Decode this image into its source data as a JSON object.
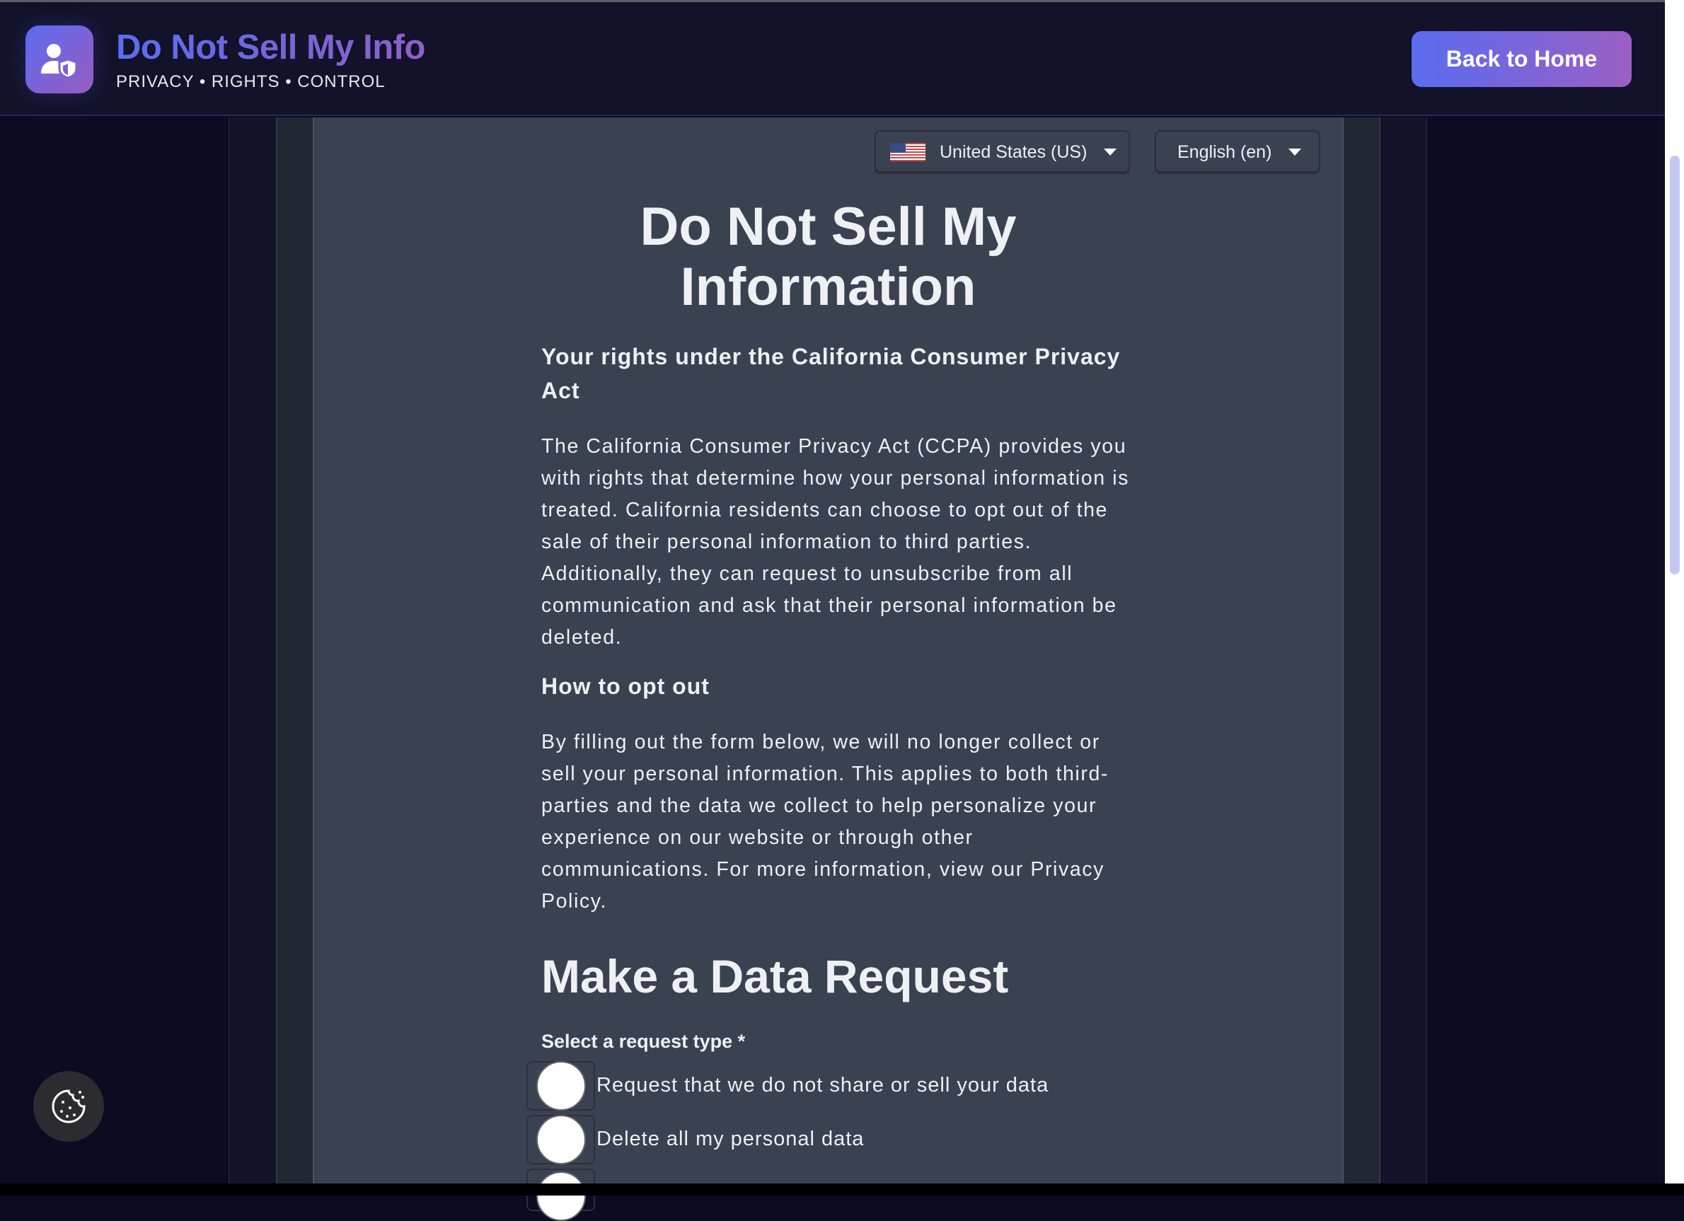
{
  "header": {
    "title": "Do Not Sell My Info",
    "subtitle": "PRIVACY • RIGHTS • CONTROL",
    "back_label": "Back to Home",
    "logo_icon": "user-shield-icon"
  },
  "selectors": {
    "country": "United States (US)",
    "language": "English (en)"
  },
  "main": {
    "title": "Do Not Sell My Information",
    "rights_heading": "Your rights under the California Consumer Privacy Act",
    "rights_text": "The California Consumer Privacy Act (CCPA) provides you with rights that determine how your personal information is treated. California residents can choose to opt out of the sale of their personal information to third parties. Additionally, they can request to unsubscribe from all communication and ask that their personal information be deleted.",
    "optout_heading": "How to opt out",
    "optout_text": "By filling out the form below, we will no longer collect or sell your personal information. This applies to both third-parties and the data we collect to help personalize your experience on our website or through other communications. For more information, view our Privacy Policy.",
    "form_heading": "Make a Data Request",
    "request_label": "Select a request type *",
    "options": [
      "Request that we do not share or sell your data",
      "Delete all my personal data"
    ]
  },
  "colors": {
    "accent_start": "#5b6cf0",
    "accent_end": "#9a5fc4",
    "content_bg": "#3a4150"
  }
}
